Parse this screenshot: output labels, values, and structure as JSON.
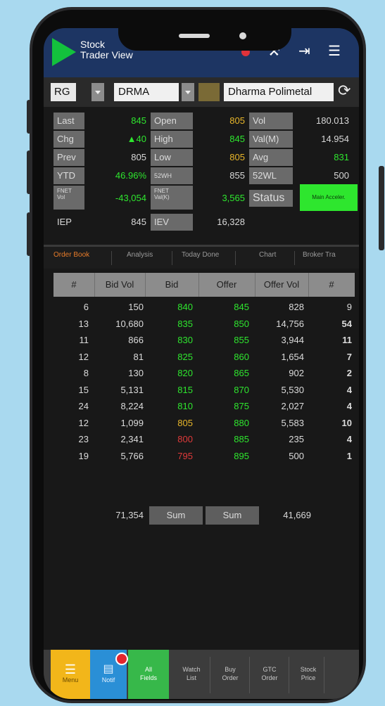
{
  "app": {
    "title_line1": "Stock",
    "title_line2": "Trader View"
  },
  "colors": {
    "appbar": "#1d3563",
    "up": "#2ee62e",
    "down": "#e03a3a",
    "neutral_yellow": "#e8b62a",
    "tab_active": "#e87c2a"
  },
  "selector": {
    "board": "RG",
    "code": "DRMA",
    "name": "Dharma Polimetal"
  },
  "stats": {
    "last_label": "Last",
    "last_value": "845",
    "open_label": "Open",
    "open_value": "805",
    "vol_label": "Vol",
    "vol_value": "180.013",
    "chg_label": "Chg",
    "chg_value": "▲40",
    "high_label": "High",
    "high_value": "845",
    "valm_label": "Val(M)",
    "valm_value": "14.954",
    "prev_label": "Prev",
    "prev_value": "805",
    "low_label": "Low",
    "low_value": "805",
    "avg_label": "Avg",
    "avg_value": "831",
    "ytd_label": "YTD",
    "ytd_value": "46.96%",
    "wh_label": "52WH",
    "wh_value": "855",
    "wl_label": "52WL",
    "wl_value": "500",
    "fnetvol_label1": "FNET",
    "fnetvol_label2": "Vol",
    "fnetvol_value": "-43,054",
    "fnetval_label1": "FNET",
    "fnetval_label2": "Val(K)",
    "fnetval_value": "3,565",
    "status_label": "Status",
    "status_value": "Main Acceler.",
    "iep_label": "IEP",
    "iep_value": "845",
    "iev_label": "IEV",
    "iev_value": "16,328"
  },
  "tabs": [
    "Order Book",
    "Analysis",
    "Today Done",
    "Chart",
    "Broker Tra"
  ],
  "orderbook": {
    "headers": [
      "#",
      "Bid Vol",
      "Bid",
      "Offer",
      "Offer Vol",
      "#"
    ],
    "rows": [
      {
        "bn": "6",
        "bvol": "150",
        "bid": "840",
        "offer": "845",
        "ovol": "828",
        "on": "9"
      },
      {
        "bn": "13",
        "bvol": "10,680",
        "bid": "835",
        "offer": "850",
        "ovol": "14,756",
        "on": "54"
      },
      {
        "bn": "11",
        "bvol": "866",
        "bid": "830",
        "offer": "855",
        "ovol": "3,944",
        "on": "11"
      },
      {
        "bn": "12",
        "bvol": "81",
        "bid": "825",
        "offer": "860",
        "ovol": "1,654",
        "on": "7"
      },
      {
        "bn": "8",
        "bvol": "130",
        "bid": "820",
        "offer": "865",
        "ovol": "902",
        "on": "2"
      },
      {
        "bn": "15",
        "bvol": "5,131",
        "bid": "815",
        "offer": "870",
        "ovol": "5,530",
        "on": "4"
      },
      {
        "bn": "24",
        "bvol": "8,224",
        "bid": "810",
        "offer": "875",
        "ovol": "2,027",
        "on": "4"
      },
      {
        "bn": "12",
        "bvol": "1,099",
        "bid": "805",
        "offer": "880",
        "ovol": "5,583",
        "on": "10"
      },
      {
        "bn": "23",
        "bvol": "2,341",
        "bid": "800",
        "offer": "885",
        "ovol": "235",
        "on": "4"
      },
      {
        "bn": "19",
        "bvol": "5,766",
        "bid": "795",
        "offer": "895",
        "ovol": "500",
        "on": "1"
      }
    ],
    "bid_colors": [
      "up",
      "up",
      "up",
      "up",
      "up",
      "up",
      "up",
      "neutral_yellow",
      "down",
      "down"
    ],
    "total_bid_vol": "71,354",
    "total_offer_vol": "41,669",
    "sum_label": "Sum"
  },
  "bottom_nav": {
    "menu": "Menu",
    "notif": "Notif",
    "all_fields": "All Fields",
    "watch_list": "Watch List",
    "buy_order": "Buy Order",
    "gtc_order": "GTC Order",
    "stock_price": "Stock Price"
  }
}
